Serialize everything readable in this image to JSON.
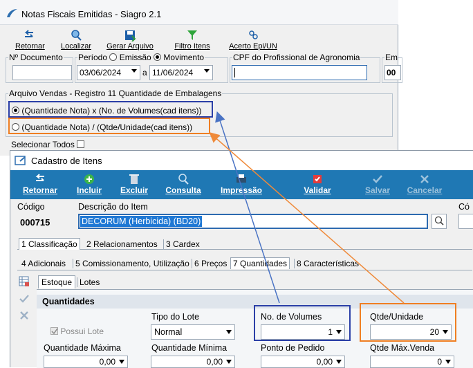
{
  "win1": {
    "title": "Notas Fiscais Emitidas - Siagro 2.1",
    "toolbar": [
      {
        "label": "Retornar",
        "icon": "back-arrow-icon"
      },
      {
        "label": "Localizar",
        "icon": "search-icon"
      },
      {
        "label": "Gerar Arquivo",
        "icon": "save-icon"
      },
      {
        "label": "Filtro Itens",
        "icon": "filter-icon"
      },
      {
        "label": "Acerto Epi/UN",
        "icon": "link-icon"
      }
    ],
    "fields": {
      "doc_label": "Nº Documento",
      "periodo_label": "Período",
      "emissao_label": "Emissão",
      "movimento_label": "Movimento",
      "date_from": "03/06/2024",
      "date_sep": "a",
      "date_to": "11/06/2024",
      "cpf_label": "CPF do Profissional de Agronomia",
      "em_label": "Em",
      "em_value": "00"
    },
    "arquivo": {
      "legend": "Arquivo Vendas - Registro 11 Quantidade de Embalagens",
      "option1": "(Quantidade Nota) x (No. de Volumes(cad itens))",
      "option2": "(Quantidade Nota) / (Qtde/Unidade(cad itens))"
    },
    "selecionar_todos": "Selecionar Todos"
  },
  "win2": {
    "title": "Cadastro de Itens",
    "toolbar": [
      {
        "label": "Retornar",
        "icon": "back-arrow-icon"
      },
      {
        "label": "Incluir",
        "icon": "plus-icon"
      },
      {
        "label": "Excluir",
        "icon": "trash-icon"
      },
      {
        "label": "Consulta",
        "icon": "search-icon"
      },
      {
        "label": "Impressão",
        "icon": "printer-icon"
      },
      {
        "label": "Validar",
        "icon": "validate-icon"
      },
      {
        "label": "Salvar",
        "icon": "check-icon"
      },
      {
        "label": "Cancelar",
        "icon": "cancel-icon"
      }
    ],
    "codigo_label": "Código",
    "codigo_value": "000715",
    "descricao_label": "Descrição do Item",
    "descricao_value": "DECORUM (Herbicida) (BD20)",
    "co_label": "Có",
    "tabs1": [
      "1 Classificação",
      "2 Relacionamentos",
      "3 Cardex"
    ],
    "tabs2": [
      "4 Adicionais",
      "5 Comissionamento, Utilização",
      "6 Preços",
      "7 Quantidades",
      "8 Características"
    ],
    "subtabs": [
      "Estoque",
      "Lotes"
    ],
    "section_title": "Quantidades",
    "possui_lote": "Possui Lote",
    "tipo_lote_label": "Tipo do Lote",
    "tipo_lote_value": "Normal",
    "no_volumes_label": "No. de Volumes",
    "no_volumes_value": "1",
    "qtde_unidade_label": "Qtde/Unidade",
    "qtde_unidade_value": "20",
    "qtd_max_label": "Quantidade Máxima",
    "qtd_max_value": "0,00",
    "qtd_min_label": "Quantidade Mínima",
    "qtd_min_value": "0,00",
    "ponto_pedido_label": "Ponto de Pedido",
    "ponto_pedido_value": "0,00",
    "qtde_max_venda_label": "Qtde Máx.Venda",
    "qtde_max_venda_value": "0"
  },
  "colors": {
    "toolbar_blue": "#1f78b4",
    "highlight_blue": "#2b3fa7",
    "highlight_orange": "#ef7e22",
    "arrow_blue": "#4a73c4",
    "arrow_orange": "#ef8a3a"
  }
}
